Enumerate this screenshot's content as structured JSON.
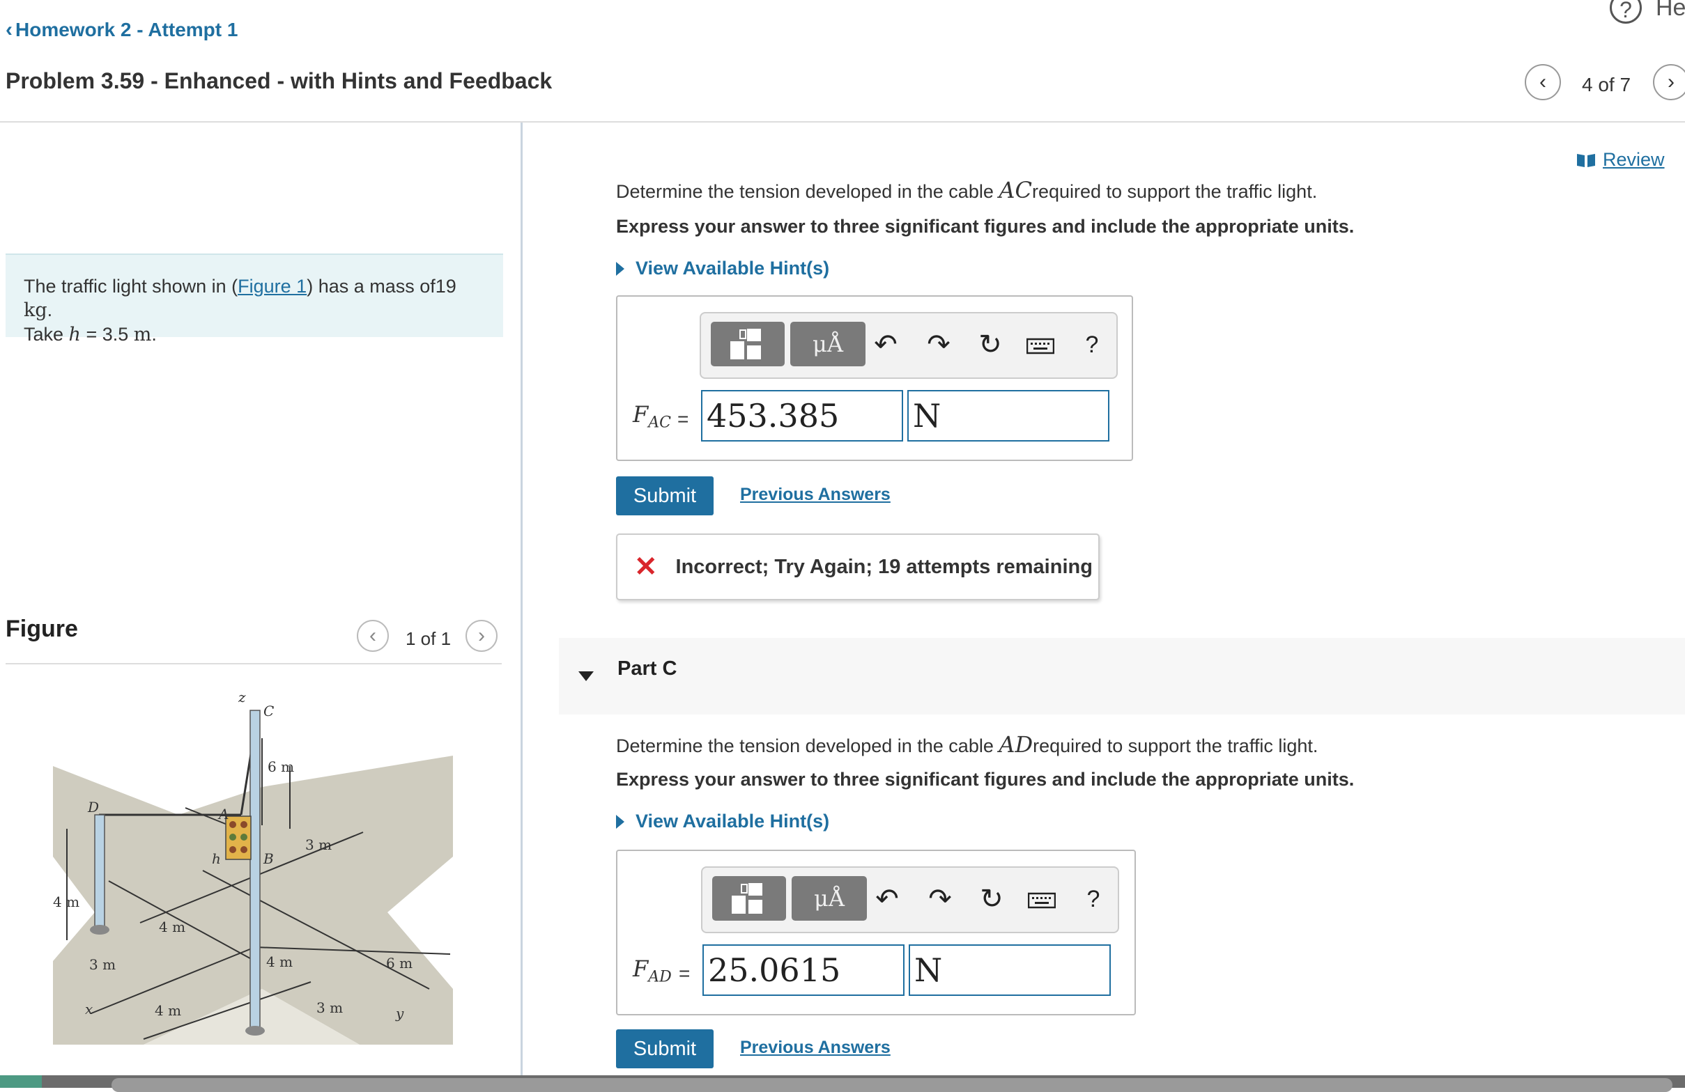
{
  "header": {
    "back_link": "Homework 2 - Attempt 1",
    "problem_title": "Problem 3.59 - Enhanced - with Hints and Feedback",
    "help_label": "Hel",
    "pagination": "4 of 7"
  },
  "left": {
    "intro_prefix": "The traffic light shown in (",
    "figure_link": "Figure 1",
    "intro_mid": ") has a mass of19 ",
    "mass_unit": "kg",
    "intro_end": ".",
    "take": "Take ",
    "h_var": "h",
    "h_eq": " = 3.5 ",
    "h_unit": "m",
    "h_end": ".",
    "figure_title": "Figure",
    "figure_pagination": "1 of 1",
    "figure_labels": {
      "z": "z",
      "C": "C",
      "six_m_top": "6 m",
      "D": "D",
      "A": "A",
      "h": "h",
      "B": "B",
      "three_m_top": "3 m",
      "four_m_left": "4 m",
      "four_m_mid": "4 m",
      "three_m_left": "3 m",
      "four_m_center": "4 m",
      "six_m_right": "6 m",
      "x": "x",
      "four_m_bottom": "4 m",
      "three_m_bottom": "3 m",
      "y": "y"
    }
  },
  "review_label": "Review",
  "part_b": {
    "question_prefix": "Determine the tension developed in the cable ",
    "cable": "AC",
    "question_suffix": "required to support the traffic light.",
    "instruction": "Express your answer to three significant figures and include the appropriate units.",
    "hint_label": "View Available Hint(s)",
    "answer_label": "F",
    "answer_sub": "AC",
    "equals": "=",
    "value": "453.385",
    "unit": "N",
    "submit": "Submit",
    "previous_answers": "Previous Answers",
    "feedback": "Incorrect; Try Again; 19 attempts remaining"
  },
  "toolbar": {
    "units_label": "μÅ",
    "help_label": "?"
  },
  "part_c": {
    "label": "Part C",
    "question_prefix": "Determine the tension developed in the cable ",
    "cable": "AD",
    "question_suffix": "required to support the traffic light.",
    "instruction": "Express your answer to three significant figures and include the appropriate units.",
    "hint_label": "View Available Hint(s)",
    "answer_label": "F",
    "answer_sub": "AD",
    "equals": "=",
    "value": "25.0615",
    "unit": "N",
    "submit": "Submit",
    "previous_answers": "Previous Answers"
  }
}
